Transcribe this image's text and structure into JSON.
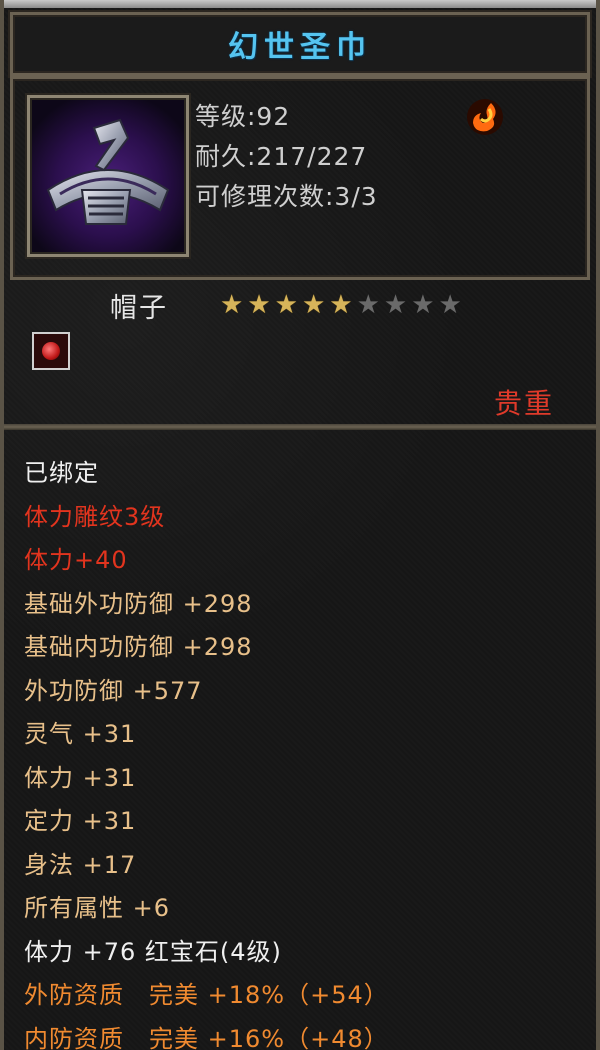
{
  "title": "幻世圣巾",
  "stats": {
    "level": "等级:92",
    "durability": "耐久:217/227",
    "repair_count": "可修理次数:3/3"
  },
  "item_type": "帽子",
  "stars": {
    "filled": 5,
    "total": 9
  },
  "rarity": "贵重",
  "icons": {
    "item_icon": "purple-headband-icon",
    "element_icon": "fire-icon",
    "gem_slot_icon": "red-gem-icon"
  },
  "colors": {
    "title": "#55c4f0",
    "red": "#e2341e",
    "gold": "#e8c08a",
    "orange": "#f08a30",
    "star_on": "#d6b45a"
  },
  "attributes": [
    {
      "text": "已绑定",
      "color": "white"
    },
    {
      "text": "体力雕纹3级",
      "color": "red"
    },
    {
      "text": "体力+40",
      "color": "red"
    },
    {
      "text": "基础外功防御 +298",
      "color": "gold"
    },
    {
      "text": "基础内功防御 +298",
      "color": "gold"
    },
    {
      "text": "外功防御 +577",
      "color": "gold"
    },
    {
      "text": "灵气 +31",
      "color": "gold"
    },
    {
      "text": "体力 +31",
      "color": "gold"
    },
    {
      "text": "定力 +31",
      "color": "gold"
    },
    {
      "text": "身法 +17",
      "color": "gold"
    },
    {
      "text": "所有属性 +6",
      "color": "gold"
    },
    {
      "text": "体力 +76 红宝石(4级)",
      "color": "white"
    },
    {
      "text": "外防资质　完美 +18%（+54）",
      "color": "orange"
    },
    {
      "text": "内防资质　完美 +16%（+48）",
      "color": "orange"
    }
  ]
}
